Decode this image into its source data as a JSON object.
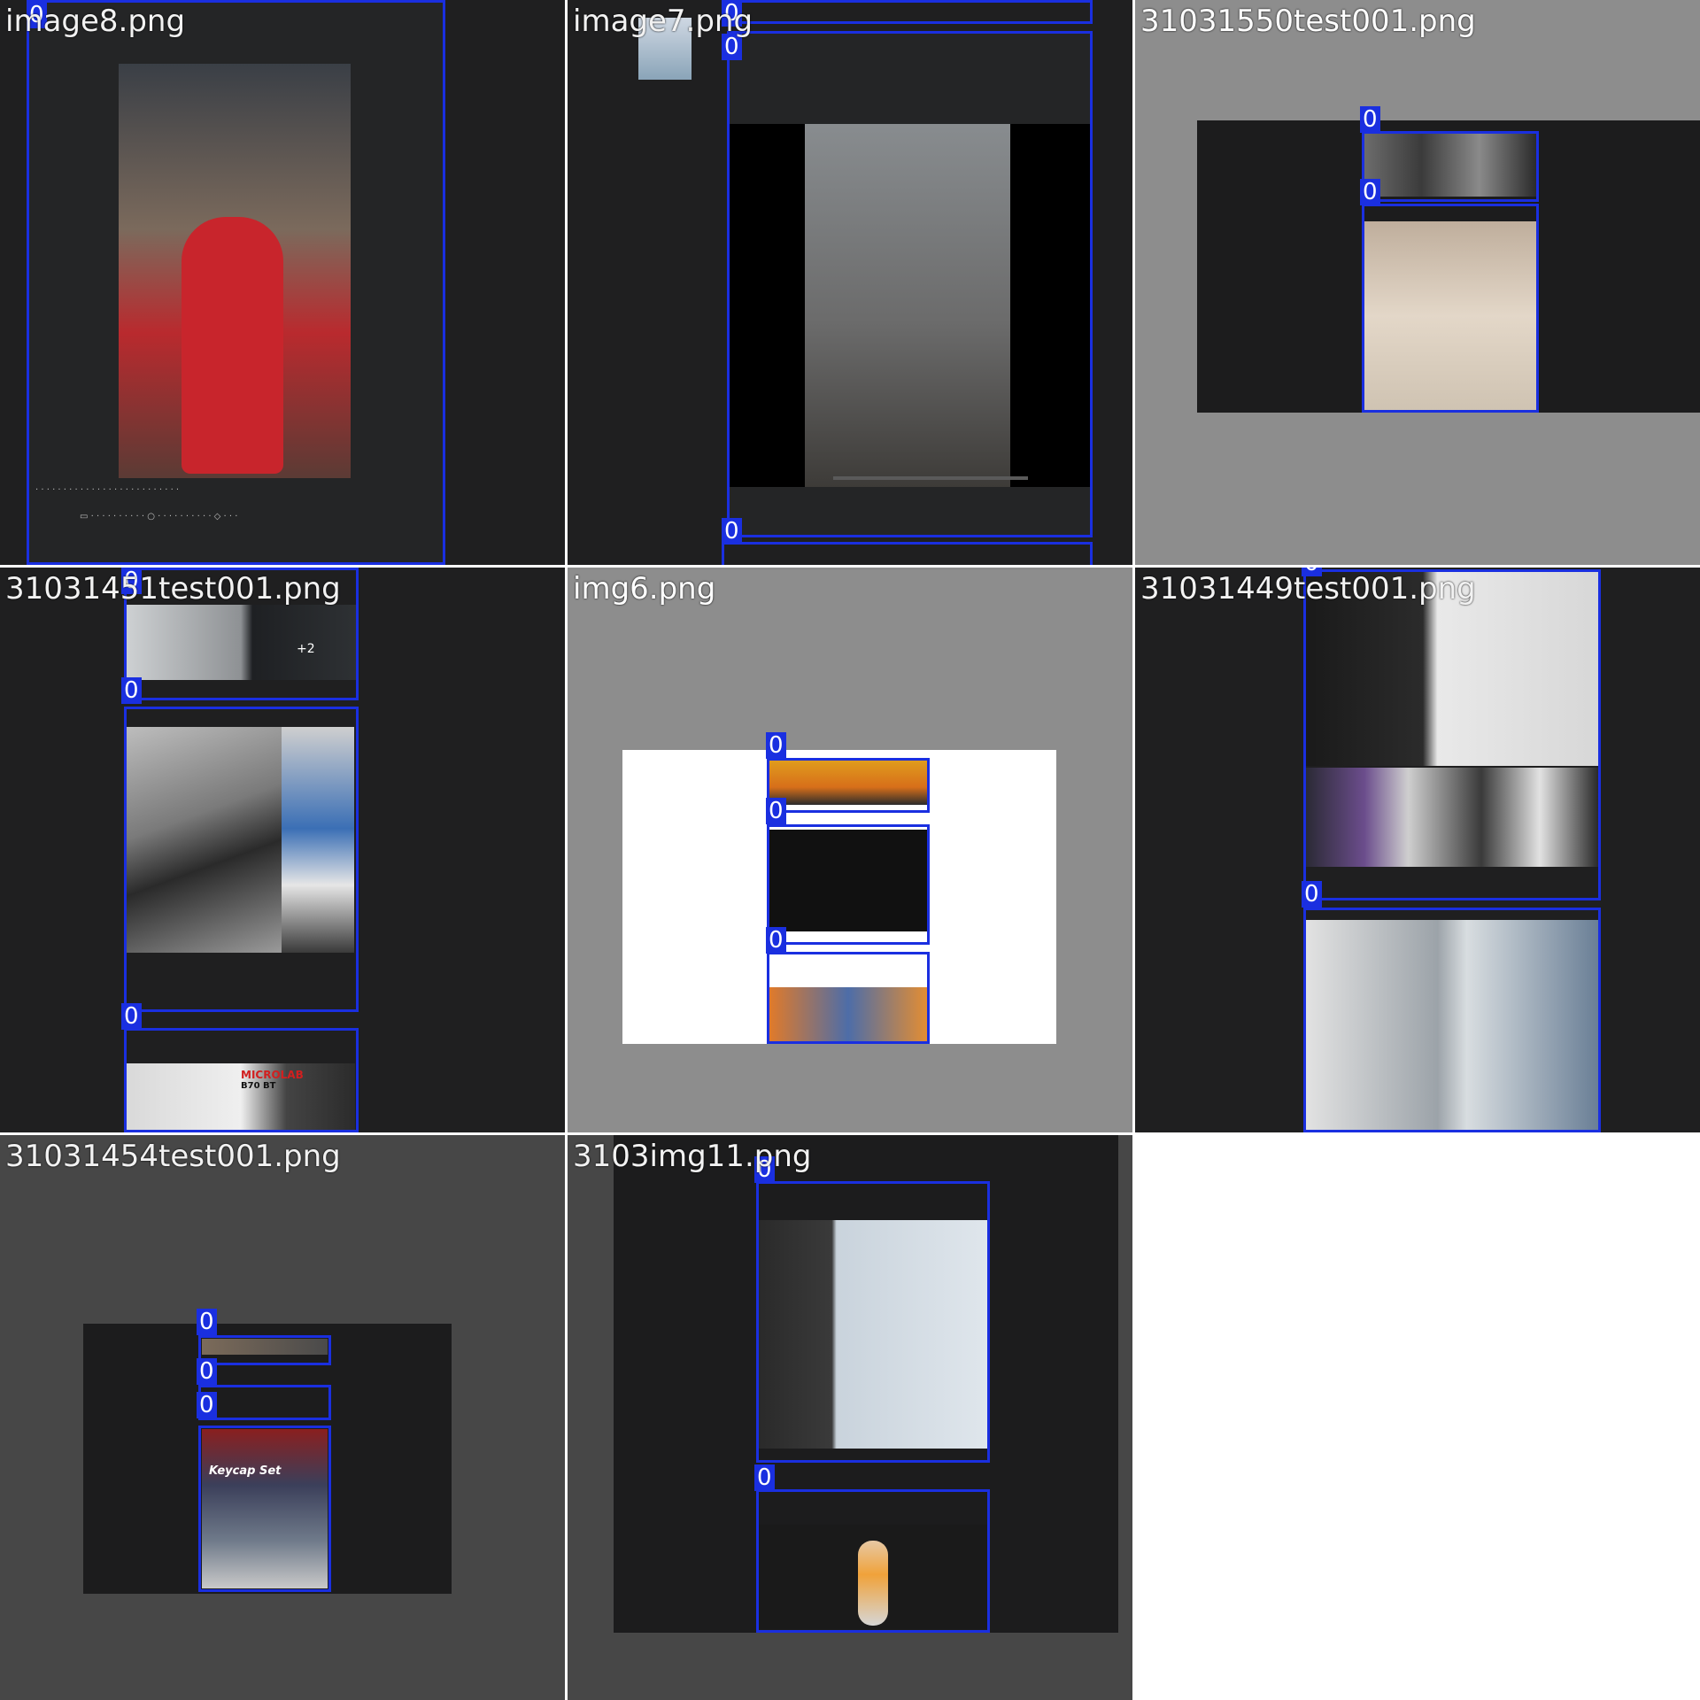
{
  "tiles": [
    {
      "filename": "image8.png",
      "class_label": "0"
    },
    {
      "filename": "image7.png",
      "class_label": "0"
    },
    {
      "filename": "31031550test001.png",
      "class_label": "0"
    },
    {
      "filename": "31031451test001.png",
      "class_label": "0"
    },
    {
      "filename": "img6.png",
      "class_label": "0"
    },
    {
      "filename": "31031449test001.png",
      "class_label": "0"
    },
    {
      "filename": "31031454test001.png",
      "class_label": "0"
    },
    {
      "filename": "3103img11.png",
      "class_label": "0"
    }
  ],
  "overlay_text": {
    "tile1_count": "+2",
    "tile3_keycap": "Keycap Set",
    "tile3_brand": "MICROLAB",
    "tile3_model": "B70 BT"
  },
  "colors": {
    "bbox": "#1a2fe0",
    "dark_bg": "#1f1f20",
    "gray_bg": "#8d8d8d"
  }
}
